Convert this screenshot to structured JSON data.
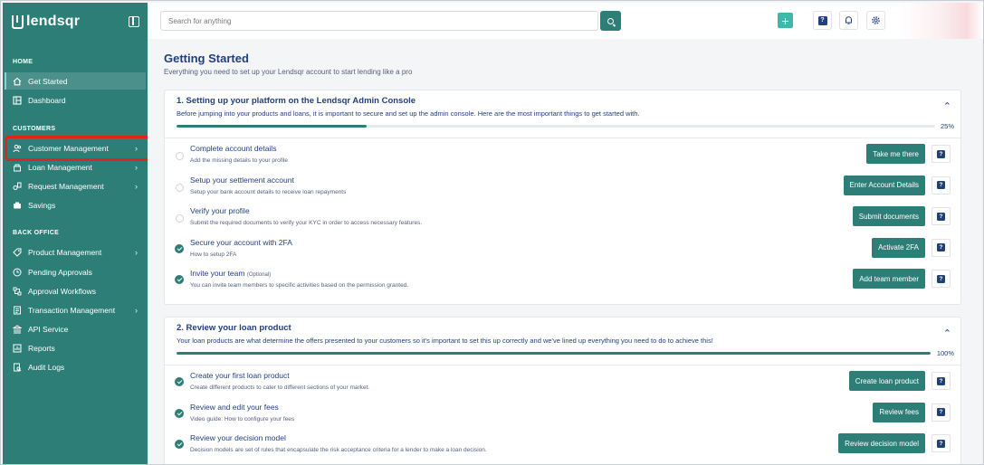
{
  "brand": {
    "name": "lendsqr"
  },
  "sidebar": {
    "sections": {
      "home": "HOME",
      "customers": "CUSTOMERS",
      "back_office": "BACK OFFICE"
    },
    "items": [
      {
        "label": "Get Started",
        "icon": "home-icon"
      },
      {
        "label": "Dashboard",
        "icon": "dashboard-icon"
      },
      {
        "label": "Customer Management",
        "icon": "users-icon"
      },
      {
        "label": "Loan Management",
        "icon": "loan-icon"
      },
      {
        "label": "Request Management",
        "icon": "request-icon"
      },
      {
        "label": "Savings",
        "icon": "savings-icon"
      },
      {
        "label": "Product Management",
        "icon": "product-icon"
      },
      {
        "label": "Pending Approvals",
        "icon": "clock-icon"
      },
      {
        "label": "Approval Workflows",
        "icon": "workflow-icon"
      },
      {
        "label": "Transaction Management",
        "icon": "transaction-icon"
      },
      {
        "label": "API Service",
        "icon": "bank-icon"
      },
      {
        "label": "Reports",
        "icon": "reports-icon"
      },
      {
        "label": "Audit Logs",
        "icon": "audit-icon"
      }
    ]
  },
  "topbar": {
    "search_placeholder": "Search for anything"
  },
  "page": {
    "title": "Getting Started",
    "subtitle": "Everything you need to set up your Lendsqr account to start lending like a pro"
  },
  "cards": [
    {
      "title": "1. Setting up your platform on the Lendsqr Admin Console",
      "description": "Before jumping into your products and loans, it is important to secure and set up the admin console. Here are the most important things to get started with.",
      "progress_label": "25%",
      "progress": 0.25,
      "tasks": [
        {
          "title": "Complete account details",
          "optional": "",
          "desc": "Add the missing details to your profile",
          "action": "Take me there",
          "done": false
        },
        {
          "title": "Setup your settlement account",
          "optional": "",
          "desc": "Setup your bank account details to receive loan repayments",
          "action": "Enter Account Details",
          "done": false
        },
        {
          "title": "Verify your profile",
          "optional": "",
          "desc": "Submit the required documents to verify your KYC in order to access necessary features.",
          "action": "Submit documents",
          "done": false
        },
        {
          "title": "Secure your account with 2FA",
          "optional": "",
          "desc": "How to setup 2FA",
          "action": "Activate 2FA",
          "done": true
        },
        {
          "title": "Invite your team",
          "optional": "(Optional)",
          "desc": "You can invite team members to specific activities based on the permission granted.",
          "action": "Add team member",
          "done": true
        }
      ]
    },
    {
      "title": "2. Review your loan product",
      "description": "Your loan products are what determine the offers presented to your customers so it's important to set this up correctly and we've lined up everything you need to do to achieve this!",
      "progress_label": "100%",
      "progress": 1.0,
      "tasks": [
        {
          "title": "Create your first loan product",
          "optional": "",
          "desc": "Create different products to cater to different sections of your market.",
          "action": "Create loan product",
          "done": true
        },
        {
          "title": "Review and edit your fees",
          "optional": "",
          "desc": "Video guide: How to configure your fees",
          "action": "Review fees",
          "done": true
        },
        {
          "title": "Review your decision model",
          "optional": "",
          "desc": "Decision models are set of rules that encapsulate the risk acceptance criteria for a lender to make a loan decision.",
          "action": "Review decision model",
          "done": true
        }
      ]
    }
  ],
  "colors": {
    "primary": "#2e7e78",
    "accent": "#3fb8ac",
    "text": "#213f7d",
    "highlight": "#e0241b"
  }
}
